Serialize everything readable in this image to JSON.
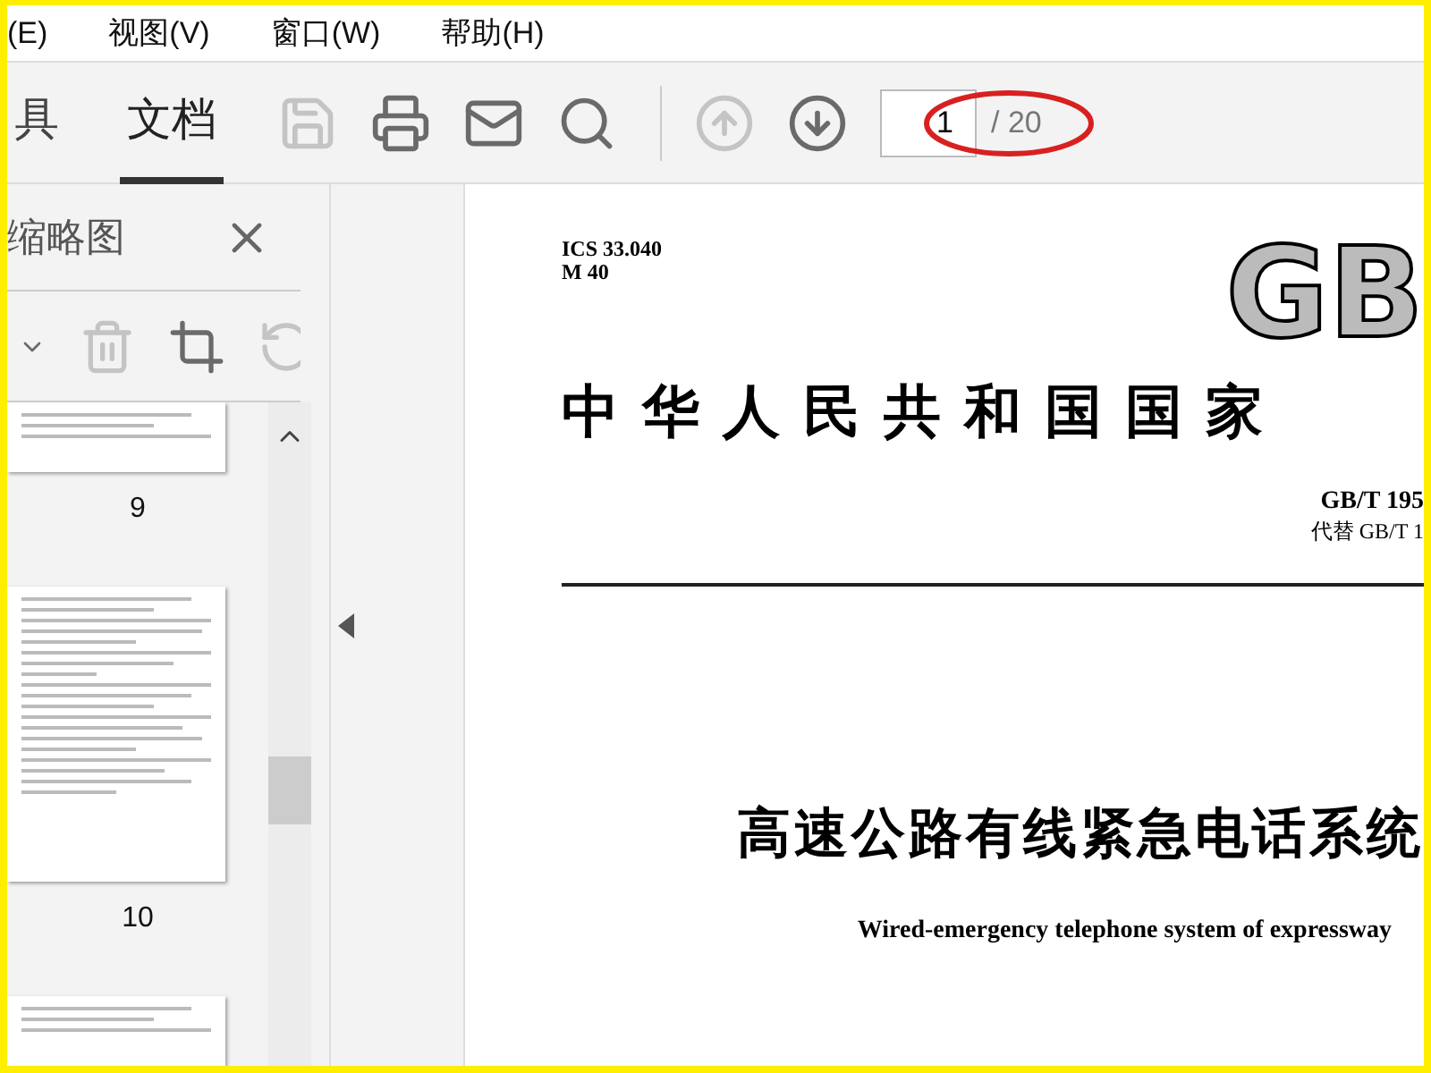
{
  "menu": [
    "(E)",
    "视图(V)",
    "窗口(W)",
    "帮助(H)"
  ],
  "tabs": [
    {
      "label": "具",
      "selected": false
    },
    {
      "label": "文档",
      "selected": true
    }
  ],
  "tools": [
    {
      "kind": "save",
      "disabled": true
    },
    {
      "kind": "print",
      "disabled": false
    },
    {
      "kind": "mail",
      "disabled": false
    },
    {
      "kind": "search",
      "disabled": false
    }
  ],
  "nav": [
    {
      "kind": "up",
      "disabled": true
    },
    {
      "kind": "down",
      "disabled": false
    }
  ],
  "page_field": {
    "value": "1",
    "total": "/ 20"
  },
  "panel": {
    "title": "缩略图",
    "tools": [
      {
        "kind": "caret",
        "disabled": false
      },
      {
        "kind": "trash",
        "disabled": true
      },
      {
        "kind": "crop",
        "disabled": false
      },
      {
        "kind": "rotate",
        "disabled": true
      }
    ],
    "thumbnails": [
      {
        "label": "9",
        "kind": "tail"
      },
      {
        "label": "10",
        "kind": "full"
      },
      {
        "kind": "head"
      }
    ]
  },
  "document": {
    "codes": [
      "ICS 33.040",
      "M 40"
    ],
    "logo": "GB",
    "heading": "中华人民共和国国家",
    "number": "GB/T 195",
    "replaces": "代替 GB/T 1",
    "title": "高速公路有线紧急电话系统",
    "subtitle": "Wired-emergency telephone system of expressway"
  }
}
